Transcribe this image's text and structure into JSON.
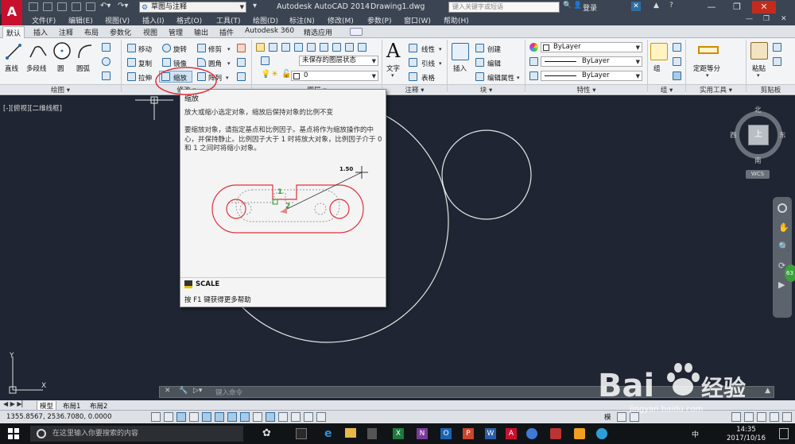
{
  "titlebar": {
    "logo": "A",
    "workspace": "草图与注释",
    "app_title": "Autodesk AutoCAD 2014",
    "file_title": "Drawing1.dwg",
    "search_placeholder": "键入关键字或短语",
    "login": "登录",
    "buttons": {
      "minimize": "—",
      "restore": "❐",
      "close": "✕"
    }
  },
  "menubar": [
    "文件(F)",
    "编辑(E)",
    "视图(V)",
    "插入(I)",
    "格式(O)",
    "工具(T)",
    "绘图(D)",
    "标注(N)",
    "修改(M)",
    "参数(P)",
    "窗口(W)",
    "帮助(H)"
  ],
  "tabs": [
    "默认",
    "插入",
    "注释",
    "布局",
    "参数化",
    "视图",
    "管理",
    "输出",
    "插件",
    "Autodesk 360",
    "精选应用"
  ],
  "ribbon": {
    "draw": {
      "title": "绘图",
      "line": "直线",
      "polyline": "多段线",
      "circle": "圆",
      "arc": "圆弧"
    },
    "modify": {
      "title": "修改",
      "move": "移动",
      "rotate": "旋转",
      "trim": "修剪",
      "copy": "复制",
      "mirror": "镜像",
      "fillet": "圆角",
      "stretch": "拉伸",
      "scale": "缩放",
      "array": "阵列"
    },
    "layers": {
      "title": "图层",
      "state": "未保存的图层状态",
      "layer0": "0"
    },
    "annotation": {
      "title": "注释",
      "text": "文字",
      "linear": "线性",
      "leader": "引线",
      "table": "表格"
    },
    "block": {
      "title": "块",
      "insert": "插入",
      "create": "创建",
      "edit": "编辑",
      "edit_attr": "编辑属性"
    },
    "properties": {
      "title": "特性",
      "color": "ByLayer",
      "linetype": "ByLayer",
      "lineweight": "ByLayer"
    },
    "groups": {
      "title": "组",
      "group": "组"
    },
    "utilities": {
      "title": "实用工具",
      "measure": "定距等分"
    },
    "clipboard": {
      "title": "剪贴板",
      "paste": "粘贴"
    }
  },
  "viewport": {
    "label": "[-][俯视][二维线框]"
  },
  "tooltip": {
    "title": "缩放",
    "desc1": "放大或缩小选定对象，缩放后保持对象的比例不变",
    "desc2": "要缩放对象，请指定基点和比例因子。基点将作为缩放操作的中心，并保持静止。比例因子大于 1 时将放大对象，比例因子介于 0 和 1 之间时将缩小对象。",
    "scale_value": "1.50",
    "point1": "1",
    "point2": "2",
    "command": "SCALE",
    "help": "按 F1 键获得更多帮助"
  },
  "compass": {
    "north": "北",
    "south": "南",
    "east": "东",
    "west": "西",
    "top": "上",
    "wcs": "WCS"
  },
  "ucs": {
    "x": "X",
    "y": "Y"
  },
  "commandline": {
    "placeholder": "键入命令"
  },
  "layout_tabs": [
    "模型",
    "布局1",
    "布局2"
  ],
  "status": {
    "coords": "1355.8567, 2536.7080, 0.0000",
    "model": "模"
  },
  "taskbar": {
    "search_placeholder": "在这里输入你要搜索的内容",
    "time": "14:35",
    "date": "2017/10/16",
    "ime": "中"
  },
  "watermark": {
    "text": "Bai",
    "text2": "经验",
    "url": "jingyan.baidu.com"
  },
  "side_badge": "63",
  "colors": {
    "accent": "#c8102e",
    "drawing_bg": "#1f2532",
    "ribbon_bg": "#f3f4f6",
    "highlight_red": "#e0303a"
  }
}
